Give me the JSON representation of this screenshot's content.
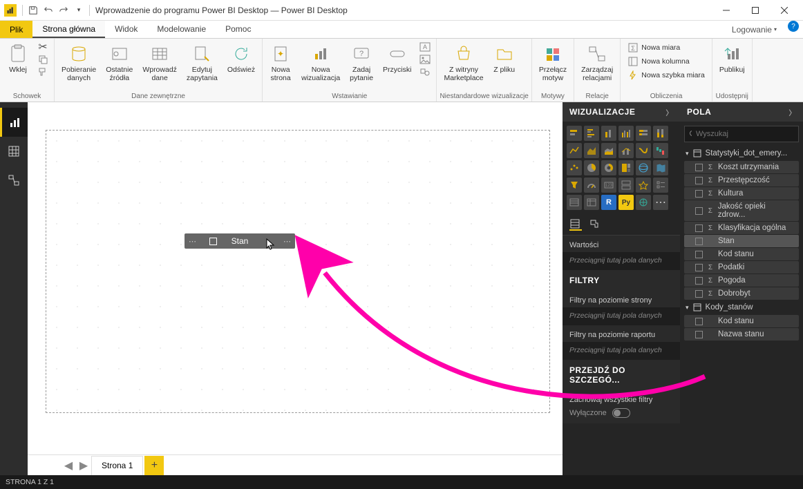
{
  "app": {
    "title": "Wprowadzenie do programu Power BI Desktop — Power BI Desktop"
  },
  "tabs": {
    "file": "Plik",
    "home": "Strona główna",
    "view": "Widok",
    "modeling": "Modelowanie",
    "help": "Pomoc",
    "login": "Logowanie"
  },
  "ribbon": {
    "groups": {
      "clipboard": "Schowek",
      "external_data": "Dane zewnętrzne",
      "insert": "Wstawianie",
      "custom_visuals": "Niestandardowe wizualizacje",
      "themes": "Motywy",
      "relationships": "Relacje",
      "calculations": "Obliczenia",
      "share": "Udostępnij"
    },
    "paste": "Wklej",
    "get_data": "Pobieranie\ndanych",
    "recent": "Ostatnie\nźródła",
    "enter_data": "Wprowadź\ndane",
    "edit_queries": "Edytuj\nzapytania",
    "refresh": "Odśwież",
    "new_page": "Nowa\nstrona",
    "new_visual": "Nowa\nwizualizacja",
    "ask": "Zadaj\npytanie",
    "buttons": "Przyciski",
    "marketplace": "Z witryny\nMarketplace",
    "from_file": "Z pliku",
    "switch_theme": "Przełącz\nmotyw",
    "manage_rel": "Zarządzaj\nrelacjami",
    "new_measure": "Nowa miara",
    "new_column": "Nowa kolumna",
    "quick_measure": "Nowa szybka miara",
    "publish": "Publikuj"
  },
  "viz_panel": {
    "title": "WIZUALIZACJE",
    "values": "Wartości",
    "drag_hint": "Przeciągnij tutaj pola danych",
    "filters": "FILTRY",
    "page_filters": "Filtry na poziomie strony",
    "report_filters": "Filtry na poziomie raportu",
    "drillthrough": "PRZEJDŹ DO SZCZEGÓ...",
    "keep_filters": "Zachowaj wszystkie filtry",
    "disabled": "Wyłączone"
  },
  "fields_panel": {
    "title": "POLA",
    "search_placeholder": "Wyszukaj",
    "table1": "Statystyki_dot_emery...",
    "fields1": [
      {
        "name": "Koszt utrzymania",
        "sigma": true
      },
      {
        "name": "Przestępczość",
        "sigma": true
      },
      {
        "name": "Kultura",
        "sigma": true
      },
      {
        "name": "Jakość opieki zdrow...",
        "sigma": true
      },
      {
        "name": "Klasyfikacja ogólna",
        "sigma": true
      },
      {
        "name": "Stan",
        "sigma": false,
        "hl": true
      },
      {
        "name": "Kod stanu",
        "sigma": false
      },
      {
        "name": "Podatki",
        "sigma": true
      },
      {
        "name": "Pogoda",
        "sigma": true
      },
      {
        "name": "Dobrobyt",
        "sigma": true
      }
    ],
    "table2": "Kody_stanów",
    "fields2": [
      {
        "name": "Kod stanu",
        "sigma": false
      },
      {
        "name": "Nazwa stanu",
        "sigma": false
      }
    ]
  },
  "canvas": {
    "dropped_field": "Stan",
    "page_tab": "Strona 1"
  },
  "status": "STRONA 1 Z 1"
}
